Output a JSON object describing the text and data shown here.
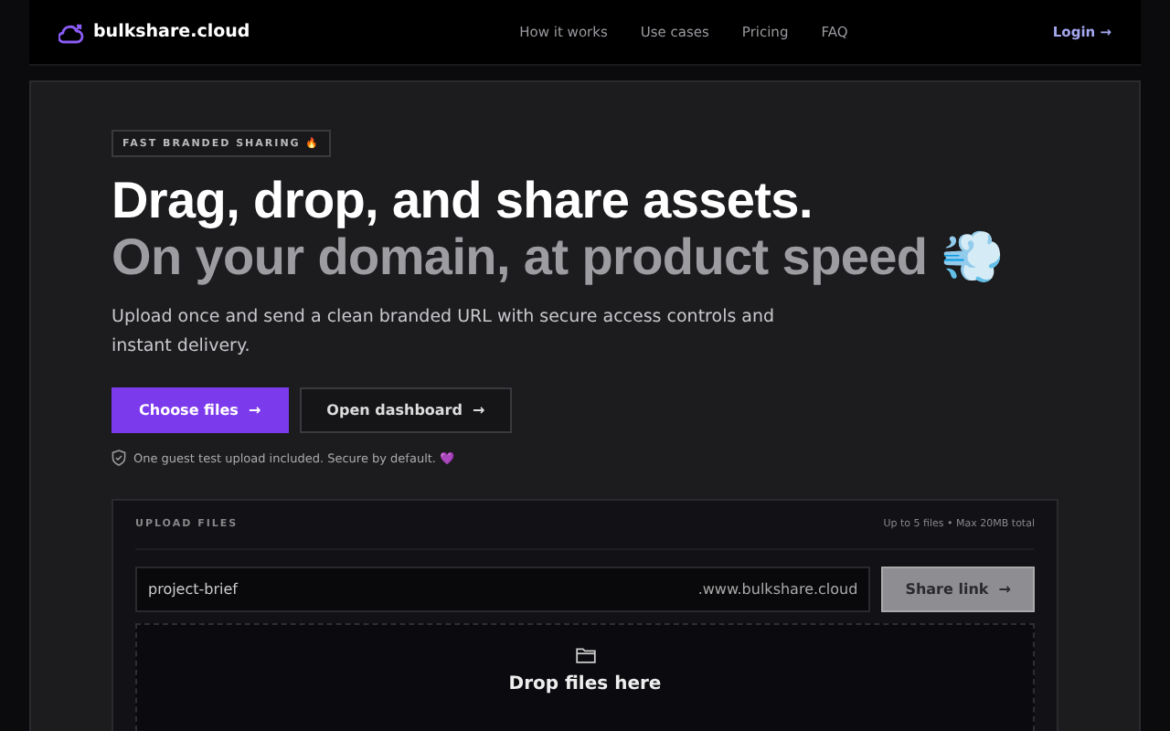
{
  "brand": {
    "name": "bulkshare.cloud"
  },
  "nav": [
    "How it works",
    "Use cases",
    "Pricing",
    "FAQ"
  ],
  "login": {
    "label": "Login",
    "arrow": "→"
  },
  "hero": {
    "badge": "FAST BRANDED SHARING 🔥",
    "title": "Drag, drop, and share assets.",
    "subtitle": "On your domain, at product speed 💨",
    "description": "Upload once and send a clean branded URL with secure access controls and instant delivery.",
    "buttons": [
      {
        "label": "Choose files",
        "arrow": "→",
        "kind": "primary"
      },
      {
        "label": "Open dashboard",
        "arrow": "→",
        "kind": "secondary"
      }
    ],
    "note": "One guest test upload included. Secure by default. 💜"
  },
  "upload": {
    "heading": "UPLOAD FILES",
    "limits": "Up to 5 files • Max 20MB total",
    "name_value": "project-brief",
    "domain_suffix": ".www.bulkshare.cloud",
    "share_button": {
      "label": "Share link",
      "arrow": "→"
    },
    "drop_text": "Drop files here"
  }
}
